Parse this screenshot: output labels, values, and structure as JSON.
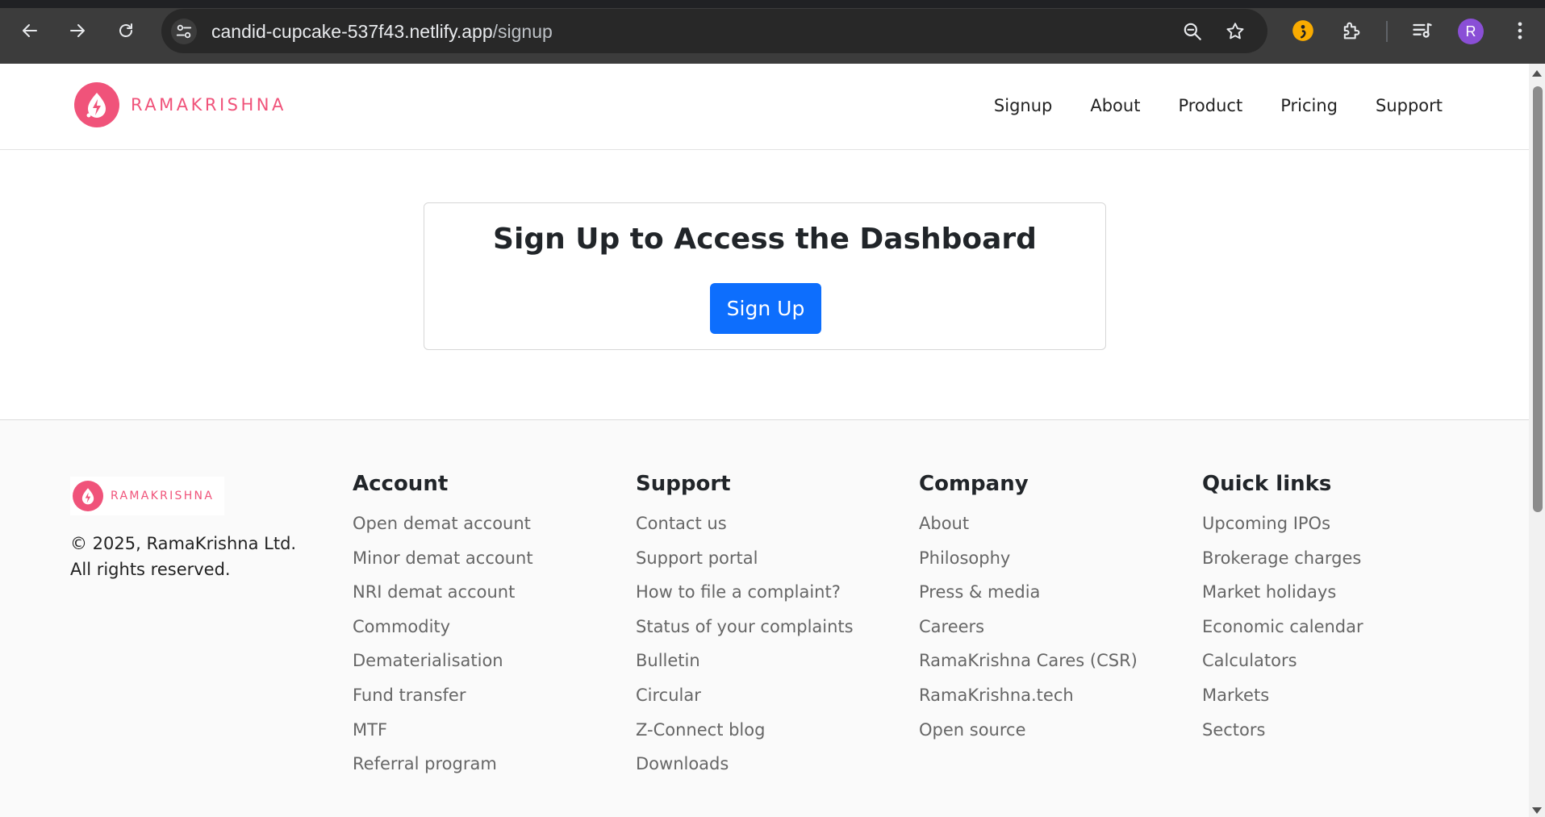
{
  "browser": {
    "url_host": "candid-cupcake-537f43.netlify.app",
    "url_path": "/signup",
    "avatar_letter": "R",
    "icons": [
      "back-arrow-icon",
      "forward-arrow-icon",
      "reload-icon",
      "site-info-icon",
      "zoom-icon",
      "bookmark-star-icon",
      "extension-semicolon-icon",
      "extensions-puzzle-icon",
      "media-queue-icon",
      "kebab-menu-icon"
    ]
  },
  "site": {
    "brand": "RAMAKRISHNA",
    "brand_color": "#f0537a",
    "nav": [
      "Signup",
      "About",
      "Product",
      "Pricing",
      "Support"
    ]
  },
  "signup_card": {
    "title": "Sign Up to Access the Dashboard",
    "button_label": "Sign Up",
    "button_color": "#0d6efd"
  },
  "footer": {
    "brand": "RAMAKRISHNA",
    "copyright_line1": "© 2025, RamaKrishna Ltd.",
    "copyright_line2": "All rights reserved.",
    "columns": [
      {
        "title": "Account",
        "links": [
          "Open demat account",
          "Minor demat account",
          "NRI demat account",
          "Commodity",
          "Dematerialisation",
          "Fund transfer",
          "MTF",
          "Referral program"
        ]
      },
      {
        "title": "Support",
        "links": [
          "Contact us",
          "Support portal",
          "How to file a complaint?",
          "Status of your complaints",
          "Bulletin",
          "Circular",
          "Z-Connect blog",
          "Downloads"
        ]
      },
      {
        "title": "Company",
        "links": [
          "About",
          "Philosophy",
          "Press & media",
          "Careers",
          "RamaKrishna Cares (CSR)",
          "RamaKrishna.tech",
          "Open source"
        ]
      },
      {
        "title": "Quick links",
        "links": [
          "Upcoming IPOs",
          "Brokerage charges",
          "Market holidays",
          "Economic calendar",
          "Calculators",
          "Markets",
          "Sectors"
        ]
      }
    ]
  }
}
